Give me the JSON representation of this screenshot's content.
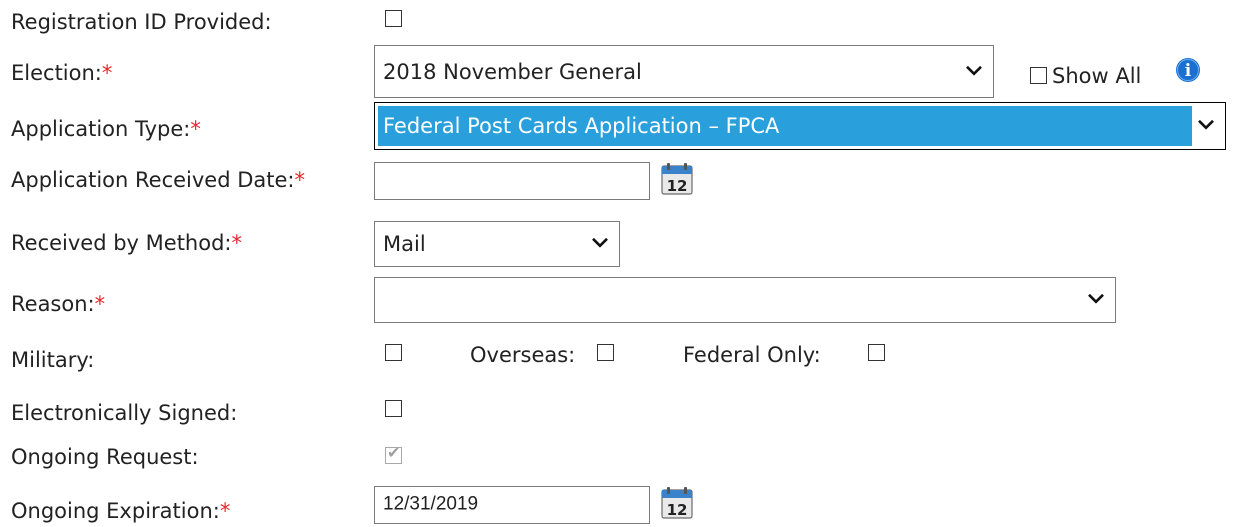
{
  "form": {
    "registration_id": {
      "label": "Registration ID Provided:"
    },
    "election": {
      "label": "Election:",
      "required": "*",
      "value": "2018 November General",
      "show_all_label": "Show All"
    },
    "application_type": {
      "label": "Application Type:",
      "required": "*",
      "value": "Federal Post Cards Application – FPCA"
    },
    "received_date": {
      "label": "Application Received Date:",
      "required": "*",
      "value": ""
    },
    "received_method": {
      "label": "Received by Method:",
      "required": "*",
      "value": "Mail"
    },
    "reason": {
      "label": "Reason:",
      "required": "*",
      "value": ""
    },
    "military": {
      "label": "Military:"
    },
    "overseas": {
      "label": "Overseas:"
    },
    "federal_only": {
      "label": "Federal Only:"
    },
    "electronically_signed": {
      "label": "Electronically Signed:"
    },
    "ongoing_request": {
      "label": "Ongoing Request:",
      "checked": true,
      "tick": "✔"
    },
    "ongoing_expiration": {
      "label": "Ongoing Expiration:",
      "required": "*",
      "value": "12/31/2019"
    }
  },
  "icons": {
    "calendar_day": "12",
    "info": "i"
  },
  "colors": {
    "required": "#e8262c",
    "selection": "#29a0dc",
    "info": "#1a6fd1"
  }
}
